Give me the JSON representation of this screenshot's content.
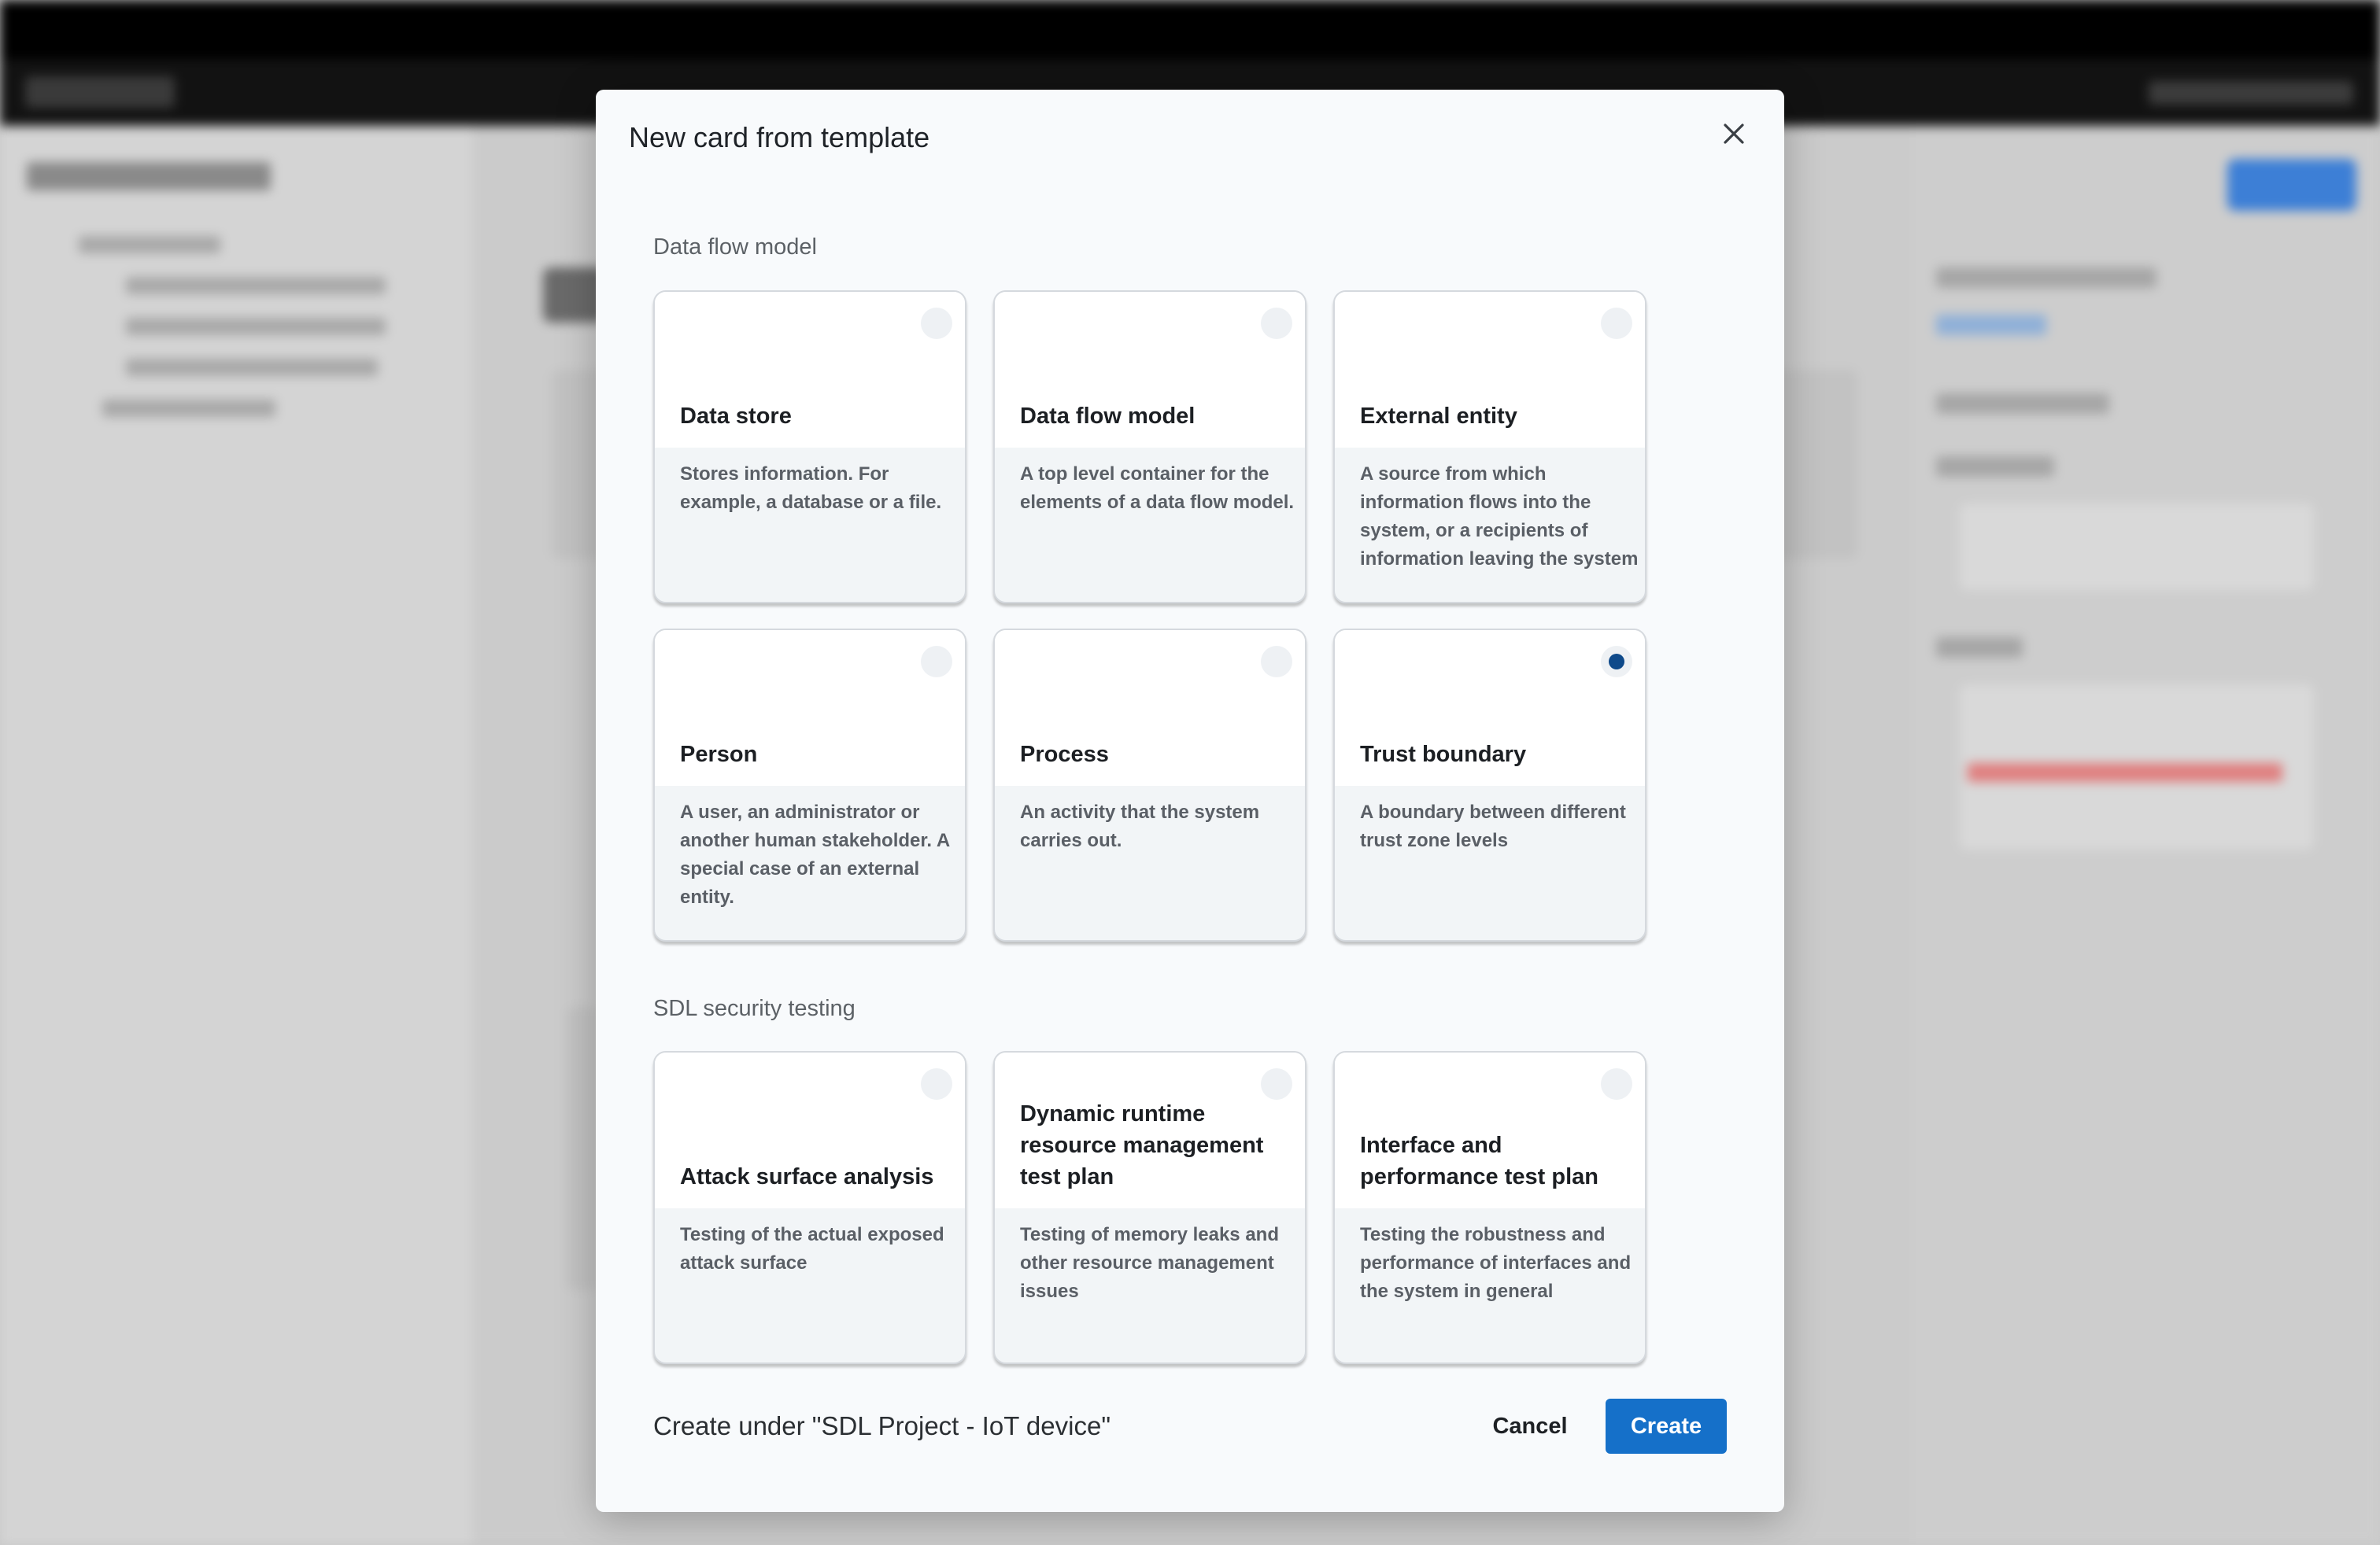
{
  "dialog": {
    "title": "New card from template",
    "close_icon": "close-icon"
  },
  "sections": [
    {
      "label": "Data flow model",
      "cards": [
        {
          "title": "Data store",
          "description": "Stores information. For example, a database or a file.",
          "selected": false
        },
        {
          "title": "Data flow model",
          "description": "A top level container for the elements of a data flow model.",
          "selected": false
        },
        {
          "title": "External entity",
          "description": "A source from which information flows into the system, or a recipients of information leaving the system",
          "selected": false
        },
        {
          "title": "Person",
          "description": "A user, an administrator or another human stakeholder. A special case of an external entity.",
          "selected": false
        },
        {
          "title": "Process",
          "description": "An activity that the system carries out.",
          "selected": false
        },
        {
          "title": "Trust boundary",
          "description": "A boundary between different trust zone levels",
          "selected": true
        }
      ]
    },
    {
      "label": "SDL security testing",
      "cards": [
        {
          "title": "Attack surface analysis",
          "description": "Testing of the actual exposed attack surface",
          "selected": false
        },
        {
          "title": "Dynamic runtime resource management test plan",
          "description": "Testing of memory leaks and other resource management issues",
          "selected": false
        },
        {
          "title": "Interface and performance test plan",
          "description": "Testing the robustness and performance of interfaces and the system in general",
          "selected": false
        }
      ]
    }
  ],
  "footer": {
    "create_under": "Create under \"SDL Project - IoT device\"",
    "cancel_label": "Cancel",
    "create_label": "Create"
  },
  "colors": {
    "primary": "#1570c9",
    "selected_radio": "#0f4a8a",
    "modal_bg": "#f8fafc"
  }
}
